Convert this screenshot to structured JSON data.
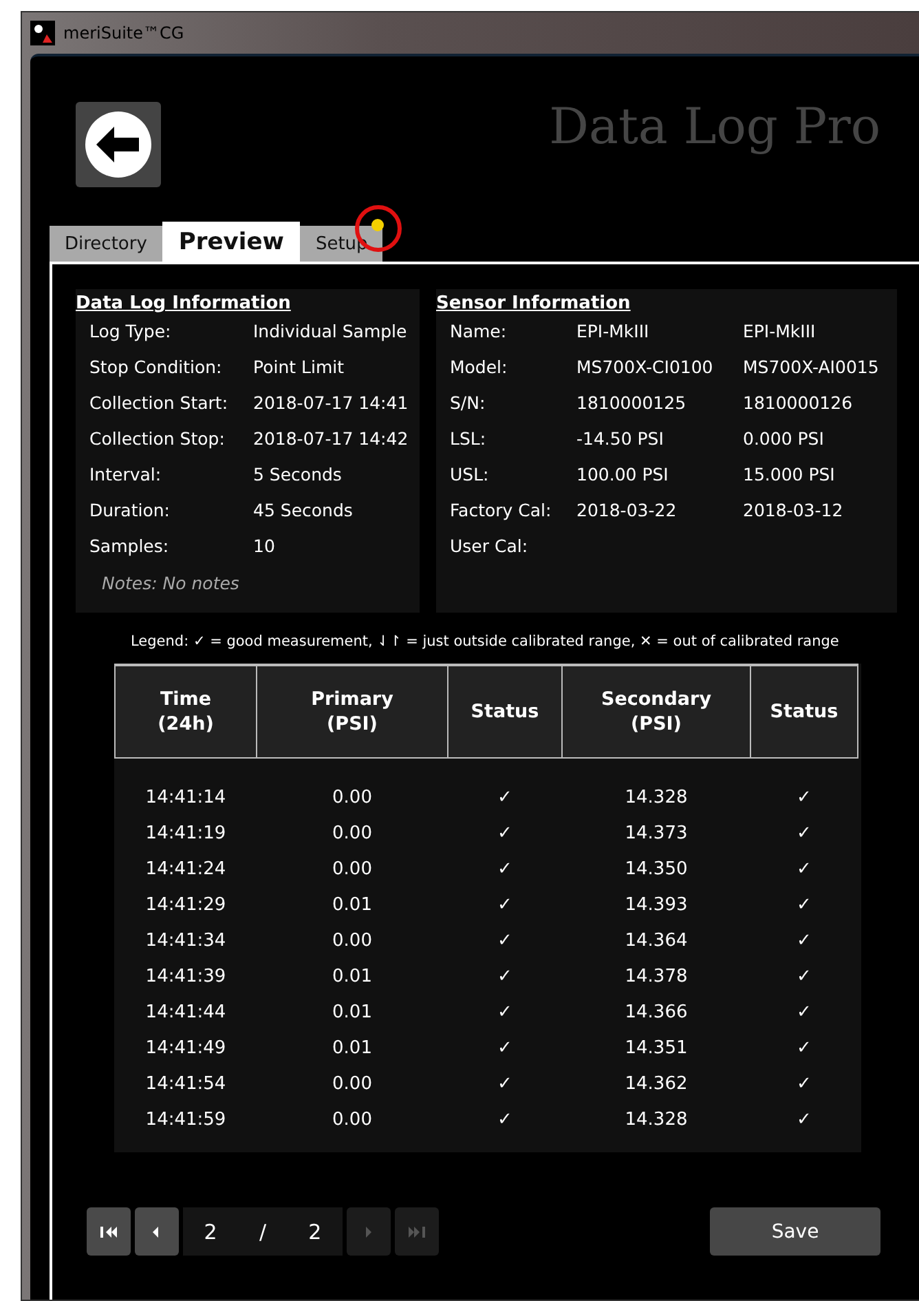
{
  "window": {
    "title": "meriSuite™CG"
  },
  "app_title": "Data Log Pro",
  "tabs": [
    {
      "label": "Directory",
      "selected": false,
      "alert": false
    },
    {
      "label": "Preview",
      "selected": true,
      "alert": false
    },
    {
      "label": "Setup",
      "selected": false,
      "alert": true
    }
  ],
  "data_log_info": {
    "title": "Data Log Information",
    "rows": [
      {
        "label": "Log Type:",
        "value": "Individual Sample"
      },
      {
        "label": "Stop Condition:",
        "value": "Point Limit"
      },
      {
        "label": "Collection Start:",
        "value": "2018-07-17  14:41"
      },
      {
        "label": "Collection Stop:",
        "value": "2018-07-17  14:42"
      },
      {
        "label": "Interval:",
        "value": "5 Seconds"
      },
      {
        "label": "Duration:",
        "value": "45 Seconds"
      },
      {
        "label": "Samples:",
        "value": "10"
      }
    ],
    "notes": "Notes: No notes"
  },
  "sensor_info": {
    "title": "Sensor Information",
    "rows": [
      {
        "label": "Name:",
        "values": [
          "EPI-MkIII",
          "EPI-MkIII"
        ]
      },
      {
        "label": "Model:",
        "values": [
          "MS700X-CI0100",
          "MS700X-AI0015"
        ]
      },
      {
        "label": "S/N:",
        "values": [
          "1810000125",
          "1810000126"
        ]
      },
      {
        "label": "LSL:",
        "values": [
          "-14.50 PSI",
          "0.000 PSI"
        ]
      },
      {
        "label": "USL:",
        "values": [
          "100.00 PSI",
          "15.000 PSI"
        ]
      },
      {
        "label": "Factory Cal:",
        "values": [
          "2018-03-22",
          "2018-03-12"
        ]
      },
      {
        "label": "User Cal:",
        "values": []
      }
    ]
  },
  "legend": "Legend:  ✓ = good measurement,  ⇃↾ = just outside calibrated range,  ✕ = out of calibrated range",
  "table": {
    "columns": [
      {
        "label": "Time",
        "unit": "(24h)"
      },
      {
        "label": "Primary",
        "unit": "(PSI)"
      },
      {
        "label": "Status"
      },
      {
        "label": "Secondary",
        "unit": "(PSI)"
      },
      {
        "label": "Status"
      }
    ],
    "rows": [
      [
        "14:41:14",
        "0.00",
        "✓",
        "14.328",
        "✓"
      ],
      [
        "14:41:19",
        "0.00",
        "✓",
        "14.373",
        "✓"
      ],
      [
        "14:41:24",
        "0.00",
        "✓",
        "14.350",
        "✓"
      ],
      [
        "14:41:29",
        "0.01",
        "✓",
        "14.393",
        "✓"
      ],
      [
        "14:41:34",
        "0.00",
        "✓",
        "14.364",
        "✓"
      ],
      [
        "14:41:39",
        "0.01",
        "✓",
        "14.378",
        "✓"
      ],
      [
        "14:41:44",
        "0.01",
        "✓",
        "14.366",
        "✓"
      ],
      [
        "14:41:49",
        "0.01",
        "✓",
        "14.351",
        "✓"
      ],
      [
        "14:41:54",
        "0.00",
        "✓",
        "14.362",
        "✓"
      ],
      [
        "14:41:59",
        "0.00",
        "✓",
        "14.328",
        "✓"
      ]
    ]
  },
  "pager": {
    "page": "2",
    "separator": "/",
    "total": "2",
    "buttons": [
      {
        "kind": "first",
        "disabled": false
      },
      {
        "kind": "prev",
        "disabled": false
      },
      {
        "kind": "next",
        "disabled": true
      },
      {
        "kind": "last",
        "disabled": true
      }
    ]
  },
  "save_button": "Save"
}
